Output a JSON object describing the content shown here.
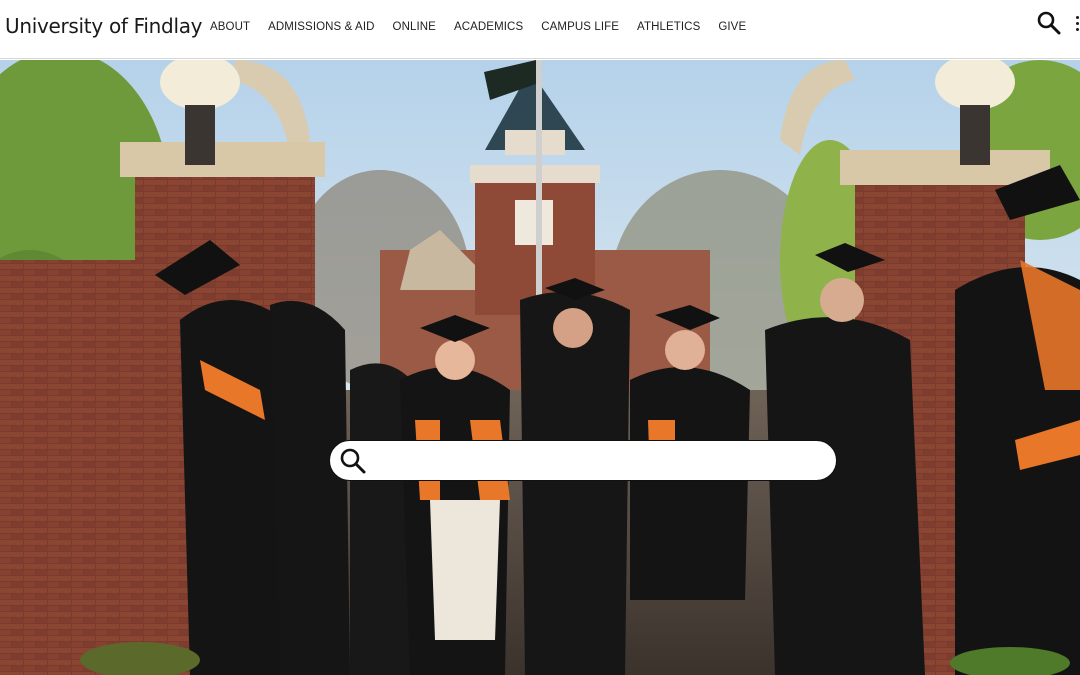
{
  "header": {
    "logo_text": "University of Findlay",
    "nav": [
      {
        "label": "ABOUT"
      },
      {
        "label": "ADMISSIONS & AID"
      },
      {
        "label": "ONLINE"
      },
      {
        "label": "ACADEMICS"
      },
      {
        "label": "CAMPUS LIFE"
      },
      {
        "label": "ATHLETICS"
      },
      {
        "label": "GIVE"
      }
    ],
    "search_icon": "search-icon",
    "menu_icon": "more-vertical-icon"
  },
  "hero": {
    "image_alt": "",
    "search": {
      "icon": "search-icon",
      "value": "",
      "placeholder": ""
    }
  },
  "colors": {
    "accent_orange": "#e8772a",
    "gown_black": "#121212",
    "brick": "#7a3b2c",
    "sky": "#b8d3ea"
  }
}
